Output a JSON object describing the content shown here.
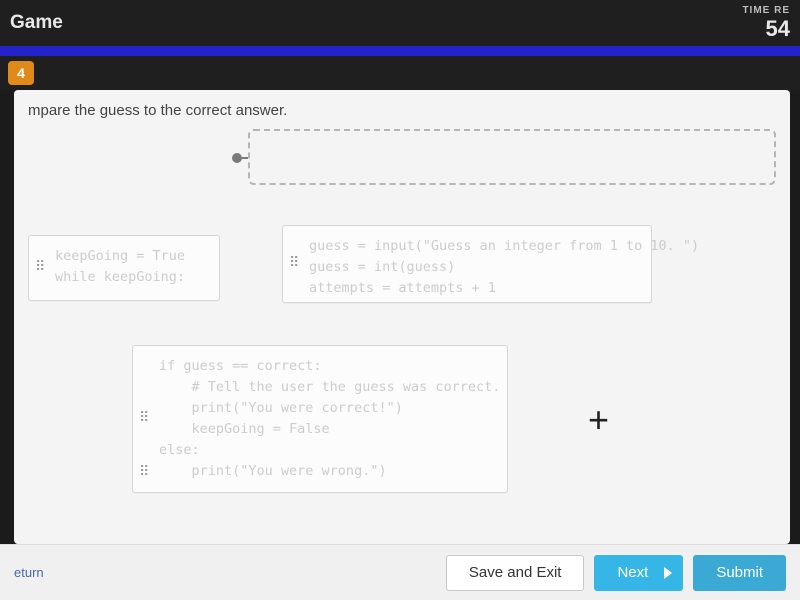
{
  "header": {
    "title_suffix": "Game",
    "time_label": "TIME RE",
    "time_value": "54"
  },
  "subhead": {
    "badge": "4"
  },
  "prompt": "mpare the guess to the correct answer.",
  "blocks": {
    "loop": {
      "line1": "keepGoing = True",
      "line2": "while keepGoing:"
    },
    "guess": {
      "line1": "guess = input(\"Guess an integer from 1 to 10. \")",
      "line2": "guess = int(guess)",
      "line3": "attempts = attempts + 1"
    },
    "check": {
      "line1": "if guess == correct:",
      "line2": "    # Tell the user the guess was correct.",
      "line3": "    print(\"You were correct!\")",
      "line4": "    keepGoing = False",
      "line5": "else:",
      "line6": "    print(\"You were wrong.\")"
    }
  },
  "actions": {
    "mark_return": "eturn",
    "save_exit": "Save and Exit",
    "next": "Next",
    "submit": "Submit"
  }
}
